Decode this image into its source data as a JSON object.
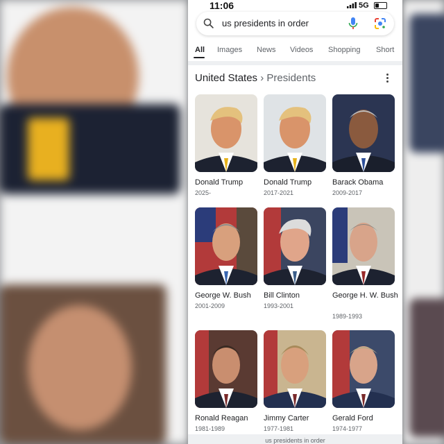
{
  "status_bar": {
    "time": "11:06",
    "network": "5G"
  },
  "search": {
    "query": "us presidents in order"
  },
  "tabs": [
    "All",
    "Images",
    "News",
    "Videos",
    "Shopping",
    "Short"
  ],
  "header": {
    "country": "United States",
    "separator": "›",
    "category": "Presidents"
  },
  "presidents": [
    {
      "name": "Donald Trump",
      "years": "2025-"
    },
    {
      "name": "Donald Trump",
      "years": "2017-2021"
    },
    {
      "name": "Barack Obama",
      "years": "2009-2017"
    },
    {
      "name": "George W. Bush",
      "years": "2001-2009"
    },
    {
      "name": "Bill Clinton",
      "years": "1993-2001"
    },
    {
      "name": "George H. W. Bush",
      "years": "1989-1993"
    },
    {
      "name": "Ronald Reagan",
      "years": "1981-1989"
    },
    {
      "name": "Jimmy Carter",
      "years": "1977-1981"
    },
    {
      "name": "Gerald Ford",
      "years": "1974-1977"
    }
  ],
  "bottom": {
    "text": "us presidents in order"
  },
  "colors": {
    "accent": "#1a73e8",
    "text": "#202124",
    "secondary": "#5f6368"
  }
}
